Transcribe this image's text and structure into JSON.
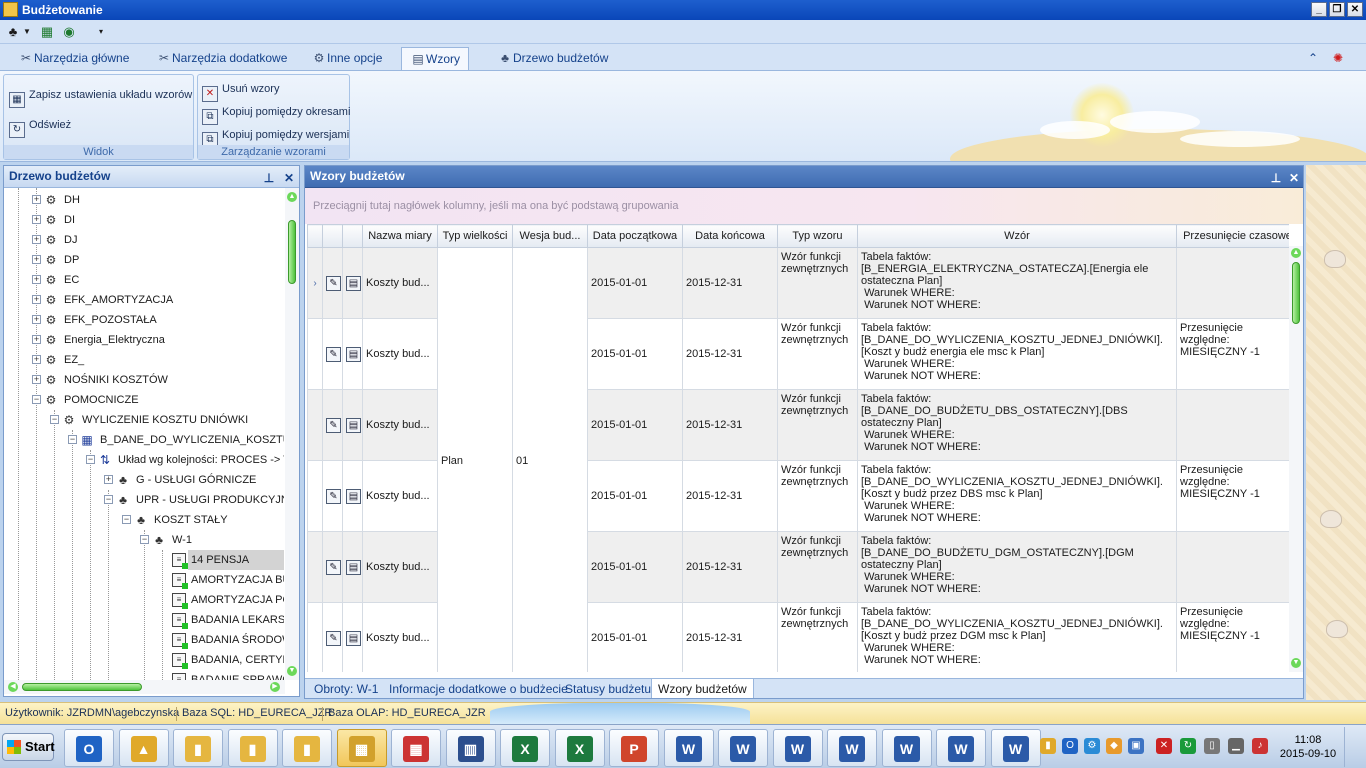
{
  "window": {
    "title": "Budżetowanie"
  },
  "tabs": [
    {
      "label": "Narzędzia główne"
    },
    {
      "label": "Narzędzia dodatkowe"
    },
    {
      "label": "Inne opcje"
    },
    {
      "label": "Wzory"
    },
    {
      "label": "Drzewo budżetów"
    }
  ],
  "ribbon": {
    "view_group": {
      "label": "Widok",
      "save_layout": "Zapisz ustawienia układu wzorów",
      "refresh": "Odśwież"
    },
    "manage_group": {
      "label": "Zarządzanie wzorami",
      "delete": "Usuń wzory",
      "copy_periods": "Kopiuj pomiędzy okresami",
      "copy_versions": "Kopiuj pomiędzy wersjami"
    }
  },
  "tree_panel": {
    "title": "Drzewo budżetów",
    "nodes": [
      {
        "label": "DH"
      },
      {
        "label": "DI"
      },
      {
        "label": "DJ"
      },
      {
        "label": "DP"
      },
      {
        "label": "EC"
      },
      {
        "label": "EFK_AMORTYZACJA"
      },
      {
        "label": "EFK_POZOSTAŁA"
      },
      {
        "label": "Energia_Elektryczna"
      },
      {
        "label": "EZ_"
      },
      {
        "label": "NOŚNIKI KOSZTÓW"
      },
      {
        "label": "POMOCNICZE"
      },
      {
        "label": "WYLICZENIE KOSZTU DNIÓWKI"
      },
      {
        "label": "B_DANE_DO_WYLICZENIA_KOSZTU_J"
      },
      {
        "label": "Układ wg kolejności: PROCES -> T"
      },
      {
        "label": "G - USŁUGI GÓRNICZE"
      },
      {
        "label": "UPR - USŁUGI PRODUKCYJNO-"
      },
      {
        "label": "KOSZT STAŁY"
      },
      {
        "label": "W-1"
      },
      {
        "label": "14 PENSJA"
      },
      {
        "label": "AMORTYZACJA BUD"
      },
      {
        "label": "AMORTYZACJA POZ"
      },
      {
        "label": "BADANIA LEKARSKI"
      },
      {
        "label": "BADANIA ŚRODOW"
      },
      {
        "label": "BADANIA, CERTYFI"
      },
      {
        "label": "BADANIE SPRAWO"
      }
    ]
  },
  "grid_panel": {
    "title": "Wzory budżetów",
    "group_hint": "Przeciągnij tutaj nagłówek kolumny, jeśli ma ona być podstawą grupowania",
    "columns": [
      "Nazwa miary",
      "Typ wielkości",
      "Wesja bud...",
      "Data początkowa",
      "Data końcowa",
      "Typ wzoru",
      "Wzór",
      "Przesunięcie czasowe"
    ],
    "merged": {
      "typ_wielkosci": "Plan",
      "wersja": "01"
    },
    "rows": [
      {
        "miara": "Koszty bud...",
        "start": "2015-01-01",
        "end": "2015-12-31",
        "typ": "Wzór funkcji zewnętrznych",
        "wzor1": "Tabela faktów:",
        "wzor2": "[B_ENERGIA_ELEKTRYCZNA_OSTATECZA].[Energia ele ostateczna Plan]",
        "wzor3": " Warunek WHERE:",
        "wzor4": " Warunek NOT WHERE:",
        "przes": ""
      },
      {
        "miara": "Koszty bud...",
        "start": "2015-01-01",
        "end": "2015-12-31",
        "typ": "Wzór funkcji zewnętrznych",
        "wzor1": "Tabela faktów:",
        "wzor2": "[B_DANE_DO_WYLICZENIA_KOSZTU_JEDNEJ_DNIÓWKI].[Koszt y budż energia ele msc k Plan]",
        "wzor3": " Warunek WHERE:",
        "wzor4": " Warunek NOT WHERE:",
        "przes": "Przesunięcie względne: MIESIĘCZNY -1"
      },
      {
        "miara": "Koszty bud...",
        "start": "2015-01-01",
        "end": "2015-12-31",
        "typ": "Wzór funkcji zewnętrznych",
        "wzor1": "Tabela faktów:",
        "wzor2": "[B_DANE_DO_BUDŻETU_DBS_OSTATECZNY].[DBS ostateczny Plan]",
        "wzor3": " Warunek WHERE:",
        "wzor4": " Warunek NOT WHERE:",
        "przes": ""
      },
      {
        "miara": "Koszty bud...",
        "start": "2015-01-01",
        "end": "2015-12-31",
        "typ": "Wzór funkcji zewnętrznych",
        "wzor1": "Tabela faktów:",
        "wzor2": "[B_DANE_DO_WYLICZENIA_KOSZTU_JEDNEJ_DNIÓWKI].[Koszt y budż przez DBS msc k Plan]",
        "wzor3": " Warunek WHERE:",
        "wzor4": " Warunek NOT WHERE:",
        "przes": "Przesunięcie względne: MIESIĘCZNY -1"
      },
      {
        "miara": "Koszty bud...",
        "start": "2015-01-01",
        "end": "2015-12-31",
        "typ": "Wzór funkcji zewnętrznych",
        "wzor1": "Tabela faktów:",
        "wzor2": "[B_DANE_DO_BUDŻETU_DGM_OSTATECZNY].[DGM ostateczny Plan]",
        "wzor3": " Warunek WHERE:",
        "wzor4": " Warunek NOT WHERE:",
        "przes": ""
      },
      {
        "miara": "Koszty bud...",
        "start": "2015-01-01",
        "end": "2015-12-31",
        "typ": "Wzór funkcji zewnętrznych",
        "wzor1": "Tabela faktów:",
        "wzor2": "[B_DANE_DO_WYLICZENIA_KOSZTU_JEDNEJ_DNIÓWKI].[Koszt y budż przez DGM msc k Plan]",
        "wzor3": " Warunek WHERE:",
        "wzor4": " Warunek NOT WHERE:",
        "przes": "Przesunięcie względne: MIESIĘCZNY -1"
      }
    ],
    "bottom_tabs": [
      {
        "label": "Obroty: W-1"
      },
      {
        "label": "Informacje dodatkowe o budżecie"
      },
      {
        "label": "Statusy budżetu"
      },
      {
        "label": "Wzory budżetów"
      }
    ]
  },
  "status": {
    "user": "Użytkownik: JZRDMN\\agebczynska",
    "sql": "Baza SQL: HD_EURECA_JZR",
    "olap": "Baza OLAP: HD_EURECA_JZR"
  },
  "taskbar": {
    "start": "Start",
    "time": "11:08",
    "date": "2015-09-10",
    "apps": [
      "outlook-icon",
      "dynamics-icon",
      "folder-icon",
      "folder-icon",
      "folder-icon",
      "budget-app-icon",
      "office-tool-icon",
      "calculator-icon",
      "excel-icon",
      "excel-icon",
      "powerpoint-icon",
      "word-icon",
      "word-icon",
      "word-icon",
      "word-icon",
      "word-icon",
      "word-icon",
      "word-icon"
    ]
  }
}
